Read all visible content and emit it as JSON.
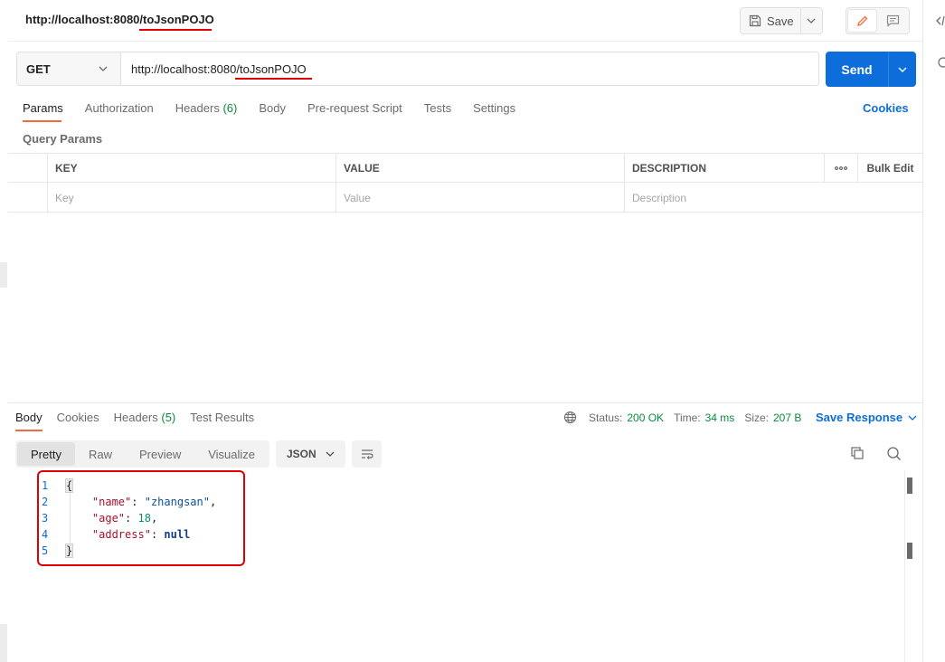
{
  "request": {
    "title_prefix": "http://localhost:8080/",
    "title_highlight": "toJsonPOJO",
    "save_label": "Save",
    "method": "GET",
    "url": "http://localhost:8080/toJsonPOJO",
    "send_label": "Send"
  },
  "request_tabs": [
    {
      "label": "Params",
      "active": true
    },
    {
      "label": "Authorization"
    },
    {
      "label": "Headers",
      "count": "(6)"
    },
    {
      "label": "Body"
    },
    {
      "label": "Pre-request Script"
    },
    {
      "label": "Tests"
    },
    {
      "label": "Settings"
    }
  ],
  "cookies_label": "Cookies",
  "query_params": {
    "label": "Query Params",
    "headers": {
      "key": "KEY",
      "value": "VALUE",
      "description": "DESCRIPTION",
      "more": "ooo",
      "bulk_edit": "Bulk Edit"
    },
    "placeholders": {
      "key": "Key",
      "value": "Value",
      "description": "Description"
    }
  },
  "response_tabs": [
    {
      "label": "Body",
      "active": true
    },
    {
      "label": "Cookies"
    },
    {
      "label": "Headers",
      "count": "(5)"
    },
    {
      "label": "Test Results"
    }
  ],
  "response_status": {
    "status_label": "Status:",
    "status_value": "200 OK",
    "time_label": "Time:",
    "time_value": "34 ms",
    "size_label": "Size:",
    "size_value": "207 B"
  },
  "save_response_label": "Save Response",
  "view_tabs": [
    "Pretty",
    "Raw",
    "Preview",
    "Visualize"
  ],
  "format_label": "JSON",
  "code_lines": [
    {
      "n": "1",
      "text": "{"
    },
    {
      "n": "2",
      "key": "\"name\"",
      "value": "\"zhangsan\"",
      "vtype": "string",
      "trail": ","
    },
    {
      "n": "3",
      "key": "\"age\"",
      "value": "18",
      "vtype": "number",
      "trail": ","
    },
    {
      "n": "4",
      "key": "\"address\"",
      "value": "null",
      "vtype": "null",
      "trail": ""
    },
    {
      "n": "5",
      "text": "}"
    }
  ],
  "colors": {
    "accent": "#0d6edb",
    "tab_active": "#f26b3a",
    "success": "#0a8a3e",
    "annotation": "#e00000"
  }
}
